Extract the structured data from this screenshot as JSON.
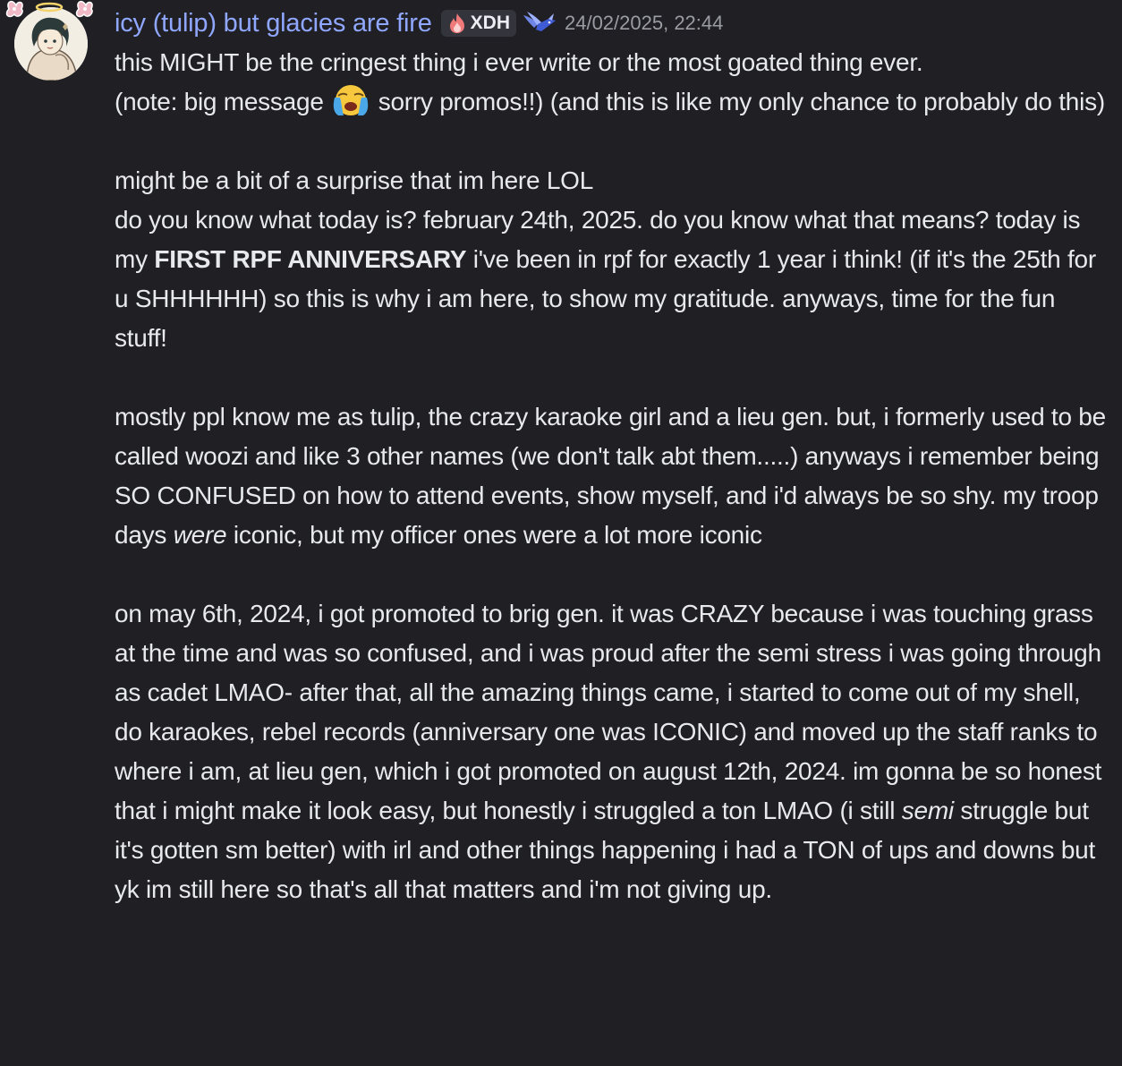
{
  "message": {
    "author": {
      "display_name": "icy (tulip) but glacies are fire",
      "avatar_icon": "avatar-anime-girl-with-halo",
      "name_color": "#90a7ff"
    },
    "tag": {
      "icon": "fire-icon",
      "label": "XDH"
    },
    "role_icon": "winged-emblem-icon",
    "timestamp": "24/02/2025, 22:44",
    "paragraphs": {
      "p1": {
        "line1": "this MIGHT be the cringest thing i ever write or the most goated thing ever.",
        "pre_emoji": "(note: big message ",
        "emoji": "loudly-crying-face-emoji",
        "post_emoji": " sorry promos!!) (and this is like my only chance to probably do this)"
      },
      "p2": {
        "line1": "might be a bit of a surprise that im here LOL",
        "pre_bold": "do you know what today is? february 24th, 2025. do you know what that means? today is my ",
        "bold": "FIRST RPF ANNIVERSARY",
        "post_bold": " i've been in rpf for exactly 1 year i think! (if it's the 25th for u SHHHHHH) so this is why i am here, to show my gratitude. anyways, time for the fun stuff!"
      },
      "p3": {
        "pre_italic": "mostly ppl know me as tulip, the crazy karaoke girl and a lieu gen. but, i formerly used to be called woozi and like 3 other names (we don't talk abt them.....) anyways i remember being SO CONFUSED on how to attend events, show myself, and i'd always be so shy. my troop days ",
        "italic": "were",
        "post_italic": " iconic, but my officer ones were a lot more iconic"
      },
      "p4": {
        "pre_italic": "on may 6th, 2024, i got promoted to brig gen. it was CRAZY because i was touching grass at the time and was so confused, and i was proud after the semi stress i was going through as cadet LMAO- after that, all the amazing things came, i started to come out of my shell, do karaokes, rebel records (anniversary one was ICONIC) and moved up the staff ranks to where i am, at lieu gen, which i got promoted on august 12th, 2024. im gonna be so honest that i might make it look easy, but honestly i struggled a ton LMAO (i still ",
        "italic": "semi",
        "post_italic": " struggle but it's gotten sm better) with irl and other things happening i had a TON of ups and downs but yk im still here so that's all that matters and i'm not giving up."
      }
    }
  },
  "colors": {
    "background": "#1f1f24",
    "text": "#e8e9ec",
    "timestamp": "#9b9ca3",
    "tag_bg": "#34353c"
  }
}
